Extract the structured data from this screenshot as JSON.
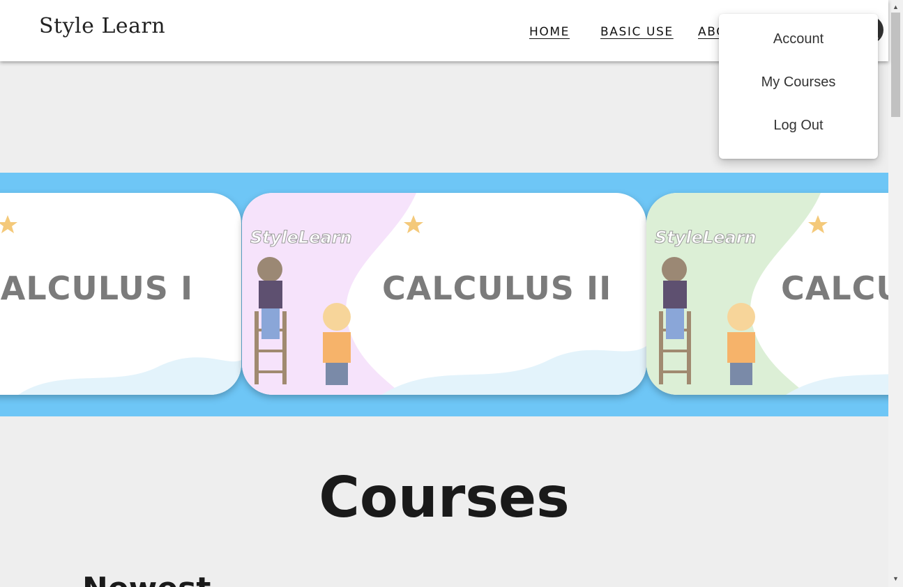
{
  "header": {
    "logo_text": "Style Learn",
    "nav": [
      {
        "label": "HOME"
      },
      {
        "label": "BASIC USE"
      },
      {
        "label": "ABOUT US"
      }
    ],
    "icons": [
      "basket-icon",
      "more-vert-icon",
      "account-circle-icon"
    ]
  },
  "account_menu": {
    "items": [
      {
        "label": "Account"
      },
      {
        "label": "My Courses"
      },
      {
        "label": "Log Out"
      }
    ]
  },
  "carousel": {
    "background": "#6ec6f6",
    "cards": [
      {
        "title": "CALCULUS I",
        "brand": "",
        "accent": "#fdf0d8"
      },
      {
        "title": "CALCULUS II",
        "brand": "StyleLearn",
        "accent": "#f6e3fb"
      },
      {
        "title": "CALCULUS III",
        "brand": "StyleLearn",
        "accent": "#dcefd6"
      }
    ]
  },
  "main": {
    "heading": "Courses",
    "subheading": "Newest"
  },
  "colors": {
    "page_bg": "#eeeeee",
    "header_bg": "#ffffff",
    "hero_bg": "#6ec6f6"
  }
}
